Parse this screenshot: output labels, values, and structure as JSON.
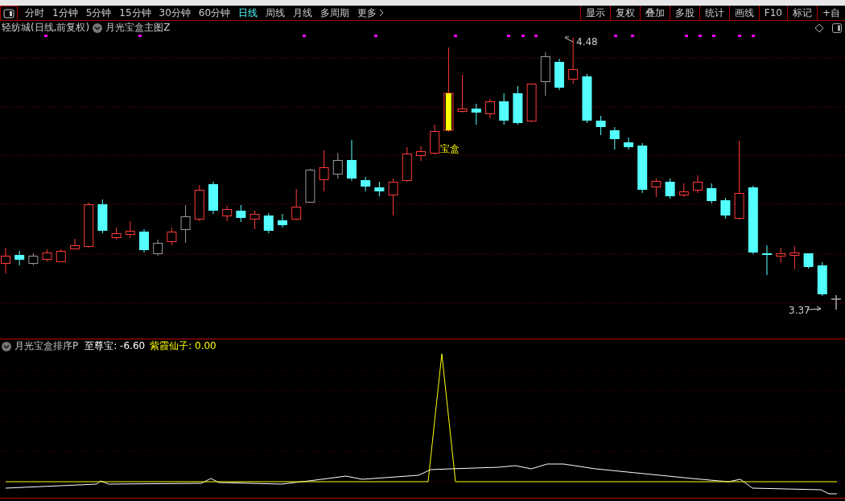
{
  "toolbar": {
    "periods": [
      {
        "label": "分时",
        "selected": false
      },
      {
        "label": "1分钟",
        "selected": false
      },
      {
        "label": "5分钟",
        "selected": false
      },
      {
        "label": "15分钟",
        "selected": false
      },
      {
        "label": "30分钟",
        "selected": false
      },
      {
        "label": "60分钟",
        "selected": false
      },
      {
        "label": "日线",
        "selected": true
      },
      {
        "label": "周线",
        "selected": false
      },
      {
        "label": "月线",
        "selected": false
      },
      {
        "label": "多周期",
        "selected": false
      },
      {
        "label": "更多",
        "selected": false
      }
    ],
    "buttons": [
      "显示",
      "复权",
      "叠加",
      "多股",
      "统计",
      "画线",
      "F10",
      "标记",
      "+自"
    ]
  },
  "main_chart": {
    "security": "轻纺城(日线,前复权)",
    "indicator": "月光宝盒主图Z",
    "high_label": "4.48",
    "low_label": "3.37",
    "signal_label": "宝盒"
  },
  "indicator_panel": {
    "name": "月光宝盒排序P",
    "values": [
      {
        "text": "至尊宝: -6.60",
        "color": "#ffffff"
      },
      {
        "text": "紫霞仙子: 0.00",
        "color": "#ffff00"
      }
    ]
  }
}
